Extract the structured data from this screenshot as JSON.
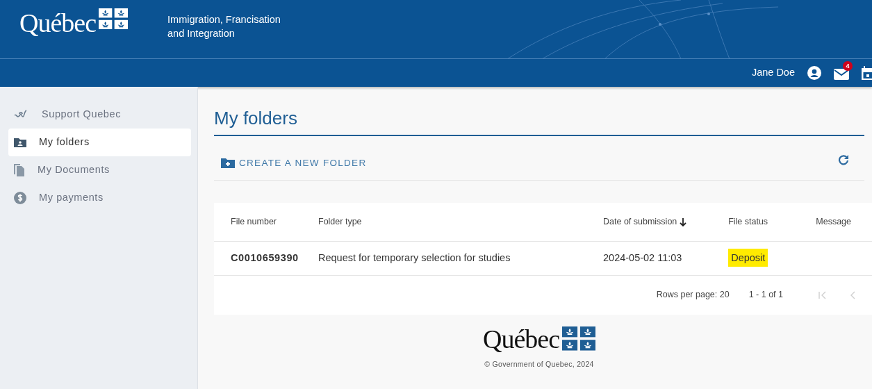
{
  "header": {
    "logo": "Québec",
    "title": "Immigration, Francisation and Integration"
  },
  "user_bar": {
    "user_name": "Jane Doe",
    "mail_badge": "4"
  },
  "sidebar": {
    "items": [
      {
        "label": "Support Quebec",
        "kind": "support",
        "selected": false
      },
      {
        "label": "My folders",
        "kind": "folder",
        "selected": true
      },
      {
        "label": "My Documents",
        "kind": "documents",
        "selected": false
      },
      {
        "label": "My payments",
        "kind": "payment",
        "selected": false
      }
    ]
  },
  "page": {
    "title": "My folders",
    "create_button": "CREATE A NEW FOLDER"
  },
  "table": {
    "columns": [
      {
        "label": "File number",
        "sorted": false
      },
      {
        "label": "Folder type",
        "sorted": false
      },
      {
        "label": "Date of submission",
        "sorted": true
      },
      {
        "label": "File status",
        "sorted": false
      },
      {
        "label": "Message",
        "sorted": false
      }
    ],
    "rows": [
      {
        "file_number": "C0010659390",
        "folder_type": "Request for temporary selection for studies",
        "date": "2024-05-02 11:03",
        "status": "Deposit",
        "highlighted": true
      }
    ],
    "pagination": {
      "rows_per_page_label": "Rows per page:",
      "rows_per_page": "20",
      "range": "1 - 1 of 1",
      "first_disabled": true,
      "prev_disabled": true
    }
  },
  "footer": {
    "logo": "Québec",
    "copyright": "© Government of Quebec, 2024"
  }
}
